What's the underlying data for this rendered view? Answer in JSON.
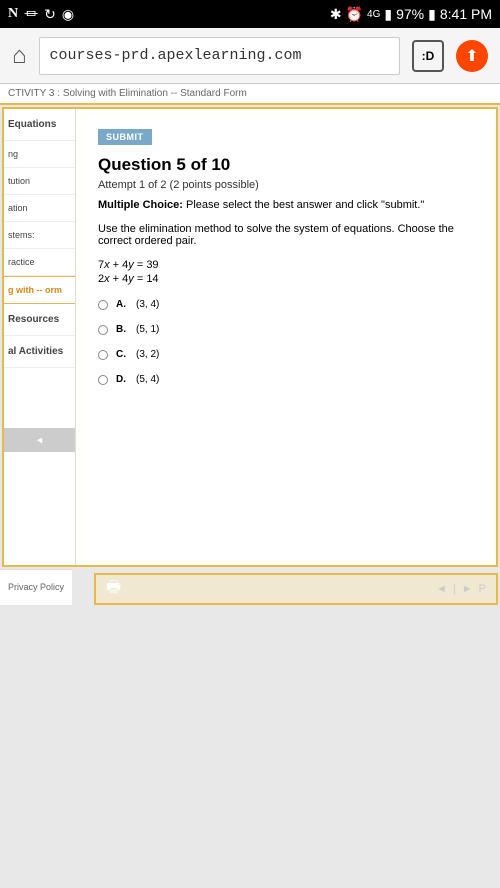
{
  "status": {
    "app_n": "N",
    "battery": "97%",
    "time": "8:41 PM"
  },
  "browser": {
    "url": "courses-prd.apexlearning.com",
    "emoji": ":D"
  },
  "activity_header": "CTIVITY 3 : Solving with Elimination -- Standard Form",
  "sidebar": {
    "head": "Equations",
    "items": [
      "ng",
      "tution",
      "ation",
      "stems:",
      "ractice"
    ],
    "active": "g with -- orm",
    "resources": "Resources",
    "activities": "al Activities"
  },
  "main": {
    "submit": "SUBMIT",
    "title": "Question 5 of 10",
    "attempt": "Attempt 1 of 2 (2 points possible)",
    "mc_bold": "Multiple Choice:",
    "mc_text": " Please select the best answer and click \"submit.\"",
    "problem": "Use the elimination method to solve the system of equations. Choose the correct ordered pair.",
    "eq1_coef1": "7",
    "eq1_var1": "x",
    "eq1_mid": " + 4",
    "eq1_var2": "y",
    "eq1_rhs": " = 39",
    "eq2_coef1": "2",
    "eq2_var1": "x",
    "eq2_mid": " + 4",
    "eq2_var2": "y",
    "eq2_rhs": " = 14",
    "options": [
      {
        "letter": "A.",
        "value": "(3, 4)"
      },
      {
        "letter": "B.",
        "value": "(5, 1)"
      },
      {
        "letter": "C.",
        "value": "(3, 2)"
      },
      {
        "letter": "D.",
        "value": "(5, 4)"
      }
    ]
  },
  "privacy": "Privacy Policy",
  "footer_nav": "P"
}
